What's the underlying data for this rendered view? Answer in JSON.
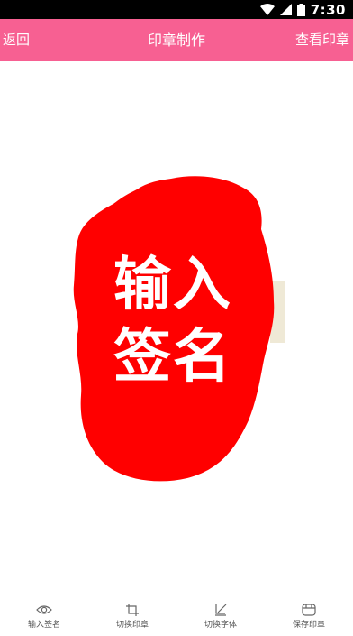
{
  "status_bar": {
    "time": "7:30"
  },
  "app_bar": {
    "back_label": "返回",
    "title": "印章制作",
    "view_label": "查看印章",
    "color": "#f76092"
  },
  "seal": {
    "line1": "输入",
    "line2": "签名",
    "color": "#ff0000"
  },
  "bottom_tabs": [
    {
      "label": "输入签名",
      "icon": "eye-icon"
    },
    {
      "label": "切换印章",
      "icon": "crop-icon"
    },
    {
      "label": "切换字体",
      "icon": "edit-font-icon"
    },
    {
      "label": "保存印章",
      "icon": "store-icon"
    }
  ]
}
